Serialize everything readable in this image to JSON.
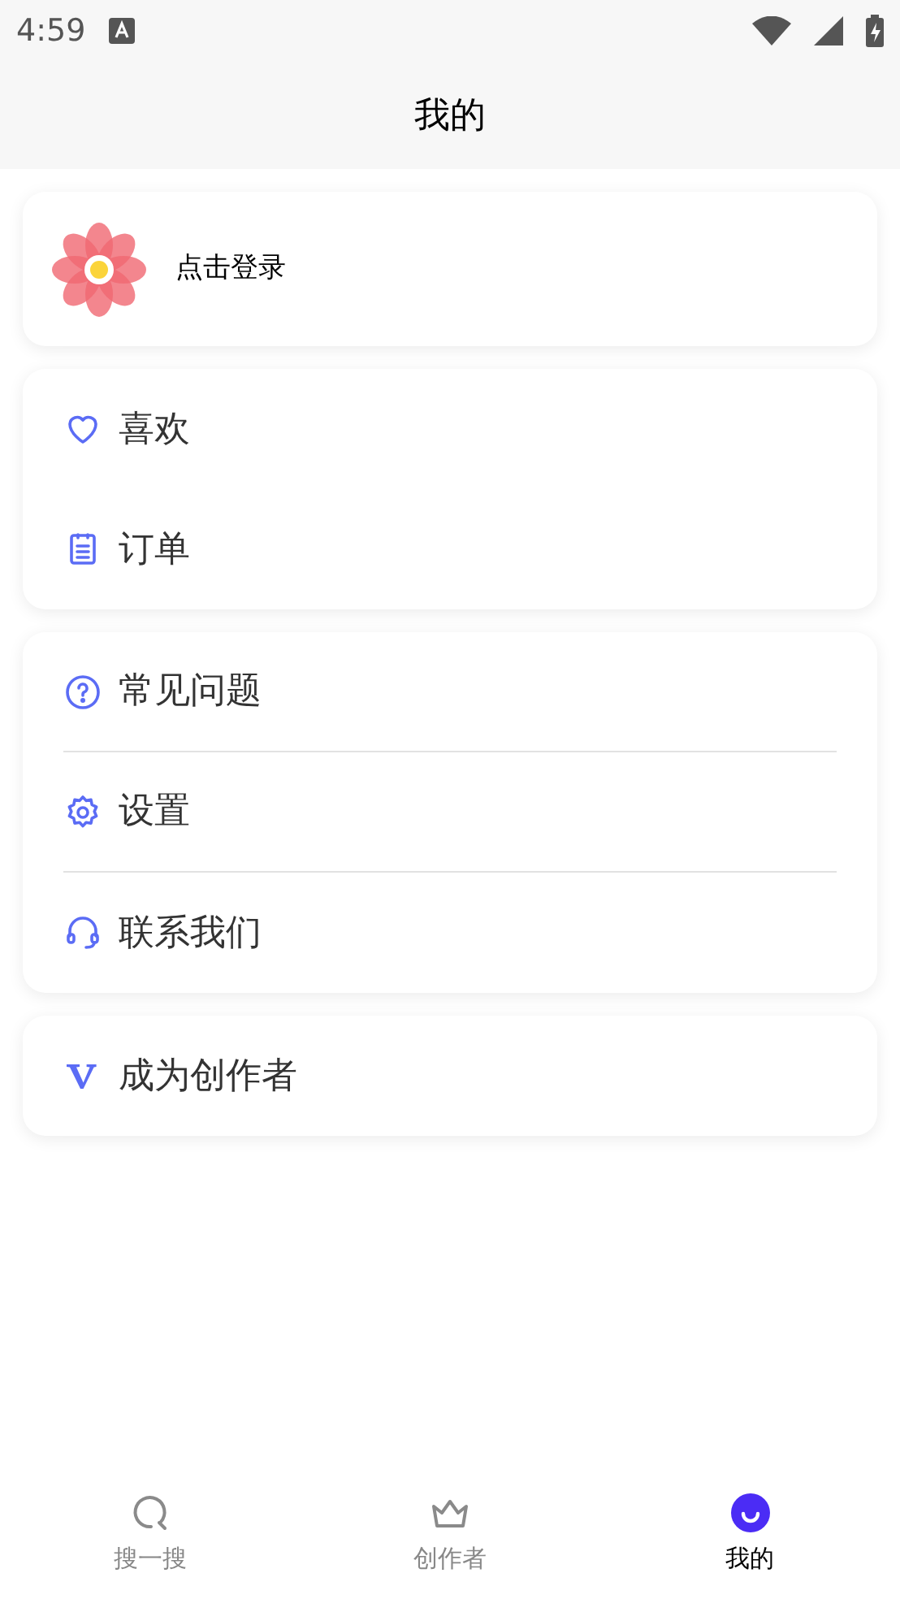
{
  "status_bar": {
    "time": "4:59"
  },
  "header": {
    "title": "我的"
  },
  "profile": {
    "login_label": "点击登录"
  },
  "menu_groups": [
    {
      "items": [
        {
          "kind": "heart",
          "label": "喜欢",
          "divider": false
        },
        {
          "kind": "list",
          "label": "订单",
          "divider": false
        }
      ]
    },
    {
      "items": [
        {
          "kind": "help",
          "label": "常见问题",
          "divider": true
        },
        {
          "kind": "gear",
          "label": "设置",
          "divider": true
        },
        {
          "kind": "headset",
          "label": "联系我们",
          "divider": false
        }
      ]
    },
    {
      "items": [
        {
          "kind": "creator",
          "label": "成为创作者",
          "divider": false
        }
      ]
    }
  ],
  "tabs": [
    {
      "kind": "search",
      "label": "搜一搜",
      "selected": false
    },
    {
      "kind": "crown",
      "label": "创作者",
      "selected": false
    },
    {
      "kind": "me",
      "label": "我的",
      "selected": true
    }
  ]
}
